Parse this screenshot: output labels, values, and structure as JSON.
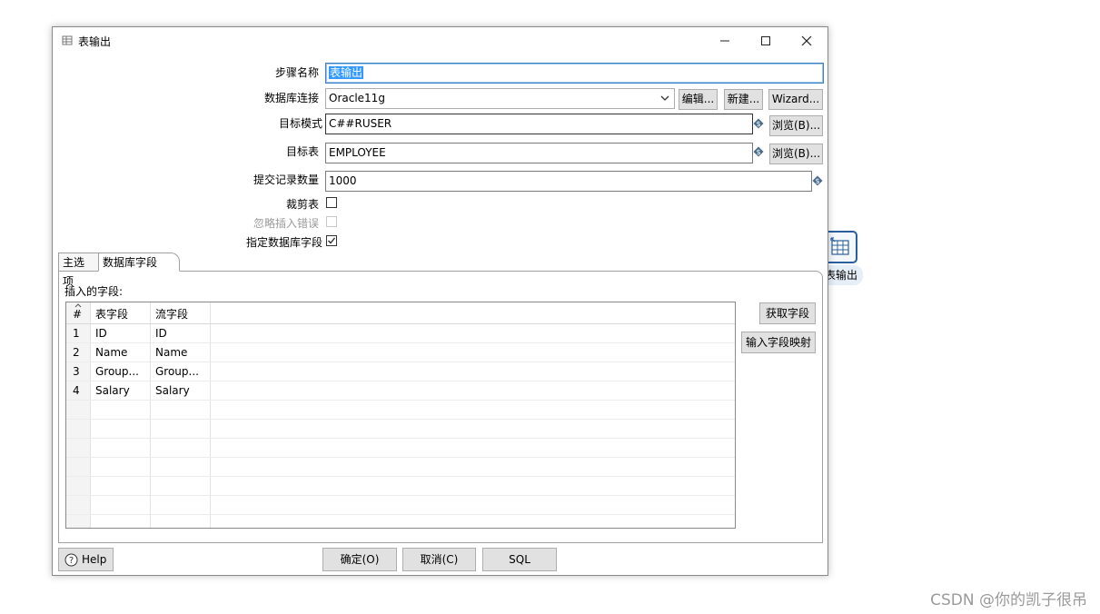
{
  "background": {
    "canvas_step_label": "表输出",
    "watermark": "CSDN @你的凯子很吊"
  },
  "dialog": {
    "title": "表输出",
    "form": {
      "step_name_label": "步骤名称",
      "step_name_value": "表输出",
      "db_connection_label": "数据库连接",
      "db_connection_value": "Oracle11g",
      "edit_button": "编辑...",
      "new_button": "新建...",
      "wizard_button": "Wizard...",
      "target_schema_label": "目标模式",
      "target_schema_value": "C##RUSER",
      "browse_schema_button": "浏览(B)...",
      "target_table_label": "目标表",
      "target_table_value": "EMPLOYEE",
      "browse_table_button": "浏览(B)...",
      "commit_size_label": "提交记录数量",
      "commit_size_value": "1000",
      "truncate_table_label": "裁剪表",
      "truncate_table_checked": false,
      "ignore_insert_errors_label": "忽略插入错误",
      "ignore_insert_errors_checked": false,
      "specify_db_fields_label": "指定数据库字段",
      "specify_db_fields_checked": true
    },
    "tabs": [
      {
        "label": "主选项",
        "active": false
      },
      {
        "label": "数据库字段",
        "active": true
      }
    ],
    "fields_section": {
      "label": "插入的字段:",
      "columns": [
        "#",
        "表字段",
        "流字段"
      ],
      "rows": [
        [
          "1",
          "ID",
          "ID"
        ],
        [
          "2",
          "Name",
          "Name"
        ],
        [
          "3",
          "Group...",
          "Group..."
        ],
        [
          "4",
          "Salary",
          "Salary"
        ]
      ],
      "get_fields_button": "获取字段",
      "input_mapping_button": "输入字段映射"
    },
    "footer": {
      "help_button": "Help",
      "ok_button": "确定(O)",
      "cancel_button": "取消(C)",
      "sql_button": "SQL"
    }
  }
}
